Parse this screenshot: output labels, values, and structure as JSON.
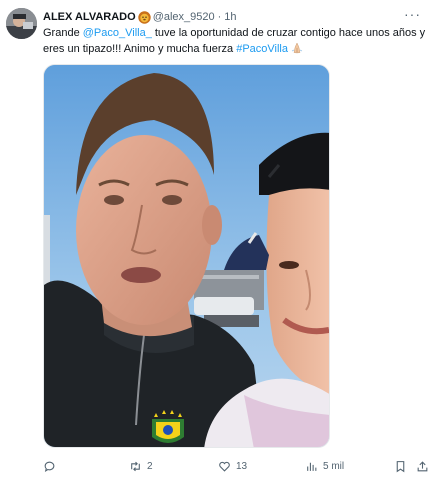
{
  "tweet": {
    "author_name": "ALEX ALVARADO",
    "author_badge_icon": "lion-emoji-icon",
    "handle": "@alex_9520",
    "separator": "·",
    "time": "1h",
    "more_icon": "more-dots-icon",
    "text": {
      "part1": "Grande ",
      "mention": "@Paco_Villa_",
      "part2": " tuve la oportunidad de cruzar contigo hace unos años y eres un tipazo!!! Animo y mucha fuerza ",
      "hashtag": "#PacoVilla",
      "emoji_icon": "praying-hands-emoji-icon"
    },
    "media": {
      "kind": "selfie-photo",
      "description_icon": "photo"
    }
  },
  "actions": {
    "reply": {
      "icon": "reply-icon",
      "count": ""
    },
    "retweet": {
      "icon": "retweet-icon",
      "count": "2"
    },
    "like": {
      "icon": "heart-icon",
      "count": "13"
    },
    "views": {
      "icon": "analytics-icon",
      "count": "5 mil"
    },
    "bookmark": {
      "icon": "bookmark-icon"
    },
    "share": {
      "icon": "share-icon"
    }
  },
  "colors": {
    "link": "#1d9bf0",
    "secondary_text": "#536471",
    "primary_text": "#0f1419"
  }
}
